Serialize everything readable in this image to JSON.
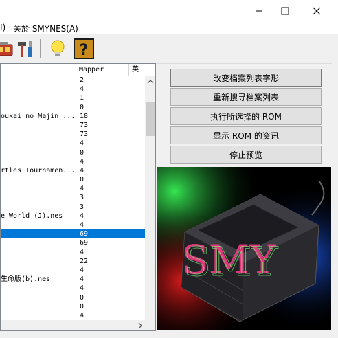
{
  "menu": {
    "item_partial": "I)",
    "about": "关於 SMYNES(A)"
  },
  "toolbar": {
    "icons": [
      "game-cartridge-icon",
      "tools-icon",
      "lightbulb-icon",
      "help-icon"
    ]
  },
  "list": {
    "columns": {
      "mapper": "Mapper",
      "english": "英"
    },
    "rows": [
      {
        "name": "",
        "mapper": "2"
      },
      {
        "name": "",
        "mapper": "4"
      },
      {
        "name": "",
        "mapper": "1"
      },
      {
        "name": "",
        "mapper": "0"
      },
      {
        "name": "oukai no Majin ...",
        "mapper": "18"
      },
      {
        "name": "",
        "mapper": "73"
      },
      {
        "name": "",
        "mapper": "73"
      },
      {
        "name": "",
        "mapper": "4"
      },
      {
        "name": "",
        "mapper": "0"
      },
      {
        "name": "",
        "mapper": "4"
      },
      {
        "name": "rtles Tournamen...",
        "mapper": "4"
      },
      {
        "name": "",
        "mapper": "0"
      },
      {
        "name": "",
        "mapper": "4"
      },
      {
        "name": "",
        "mapper": "3"
      },
      {
        "name": "",
        "mapper": "3"
      },
      {
        "name": "e World (J).nes",
        "mapper": "4"
      },
      {
        "name": "",
        "mapper": "4"
      },
      {
        "name": "",
        "mapper": "69"
      },
      {
        "name": "",
        "mapper": "69"
      },
      {
        "name": "",
        "mapper": "4"
      },
      {
        "name": "",
        "mapper": "22"
      },
      {
        "name": "",
        "mapper": "4"
      },
      {
        "name": "生命版(b).nes",
        "mapper": "4"
      },
      {
        "name": "",
        "mapper": "4"
      },
      {
        "name": "",
        "mapper": "0"
      },
      {
        "name": "",
        "mapper": "0"
      },
      {
        "name": "",
        "mapper": "4"
      },
      {
        "name": "",
        "mapper": "4"
      }
    ],
    "selected_row_index": 17
  },
  "buttons": {
    "change_font": "改变档案列表字形",
    "research_list": "重新搜寻档案列表",
    "run_rom": "执行所选择的 ROM",
    "show_rom_info": "显示 ROM 的资讯",
    "stop_preview": "停止预览"
  },
  "preview": {
    "logo_text": "SMY"
  },
  "colors": {
    "selection": "#0078d7",
    "button_face": "#e1e1e1"
  }
}
